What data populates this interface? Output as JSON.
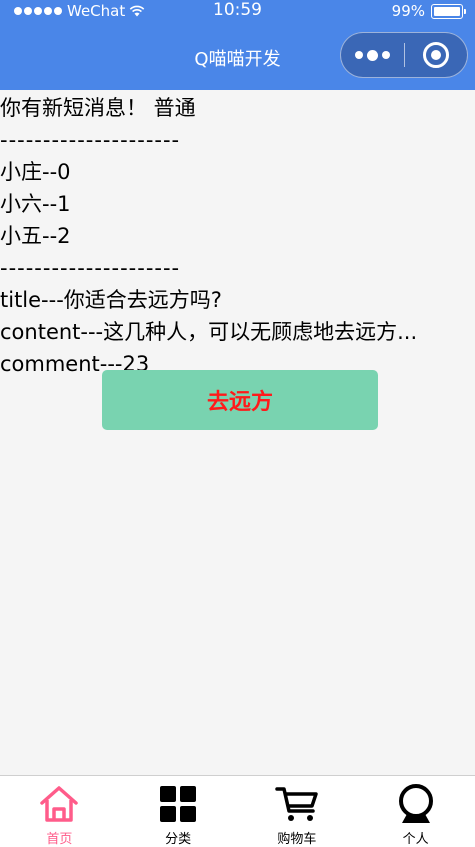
{
  "status_bar": {
    "carrier": "WeChat",
    "time": "10:59",
    "battery": "99%"
  },
  "nav": {
    "title": "Q喵喵开发"
  },
  "content": {
    "notice": "你有新短消息！ 普通",
    "divider": "---------------------",
    "names": [
      "小庄--0",
      "小六--1",
      "小五--2"
    ],
    "title_line": "title---你适合去远方吗?",
    "content_line": "content---这几种人，可以无顾虑地去远方...",
    "comment_line": "comment---23"
  },
  "button": {
    "label": "去远方"
  },
  "tabbar": {
    "items": [
      {
        "label": "首页",
        "icon": "home-icon",
        "active": true
      },
      {
        "label": "分类",
        "icon": "grid-icon",
        "active": false
      },
      {
        "label": "购物车",
        "icon": "cart-icon",
        "active": false
      },
      {
        "label": "个人",
        "icon": "user-icon",
        "active": false
      }
    ]
  },
  "colors": {
    "nav_background": "#4a86e8",
    "button_background": "#79d3b0",
    "button_text": "#ff1a1a",
    "tab_active": "#ff5c8a",
    "page_background": "#f5f5f5"
  }
}
